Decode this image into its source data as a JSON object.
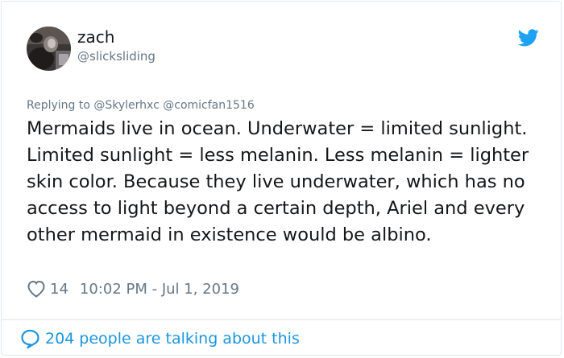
{
  "author": {
    "name": "zach",
    "handle": "@slicksliding",
    "avatar_icon": "profile-photo"
  },
  "brand_icon": "twitter-bird-icon",
  "reply": {
    "prefix": "Replying to",
    "mentions": [
      "@Skylerhxc",
      "@comicfan1516"
    ]
  },
  "tweet": {
    "text": "Mermaids live in ocean. Underwater = limited sunlight. Limited sunlight = less melanin. Less melanin = lighter skin color. Because they live underwater, which has no access to light beyond a certain depth, Ariel and every other mermaid in existence would be albino."
  },
  "meta": {
    "like_count": "14",
    "timestamp": "10:02 PM - Jul 1, 2019"
  },
  "footer": {
    "talking_text": "204 people are talking about this"
  },
  "colors": {
    "text": "#14171a",
    "secondary": "#657786",
    "accent": "#1da1f2",
    "link": "#1b95e0",
    "border": "#e1e8ed"
  }
}
